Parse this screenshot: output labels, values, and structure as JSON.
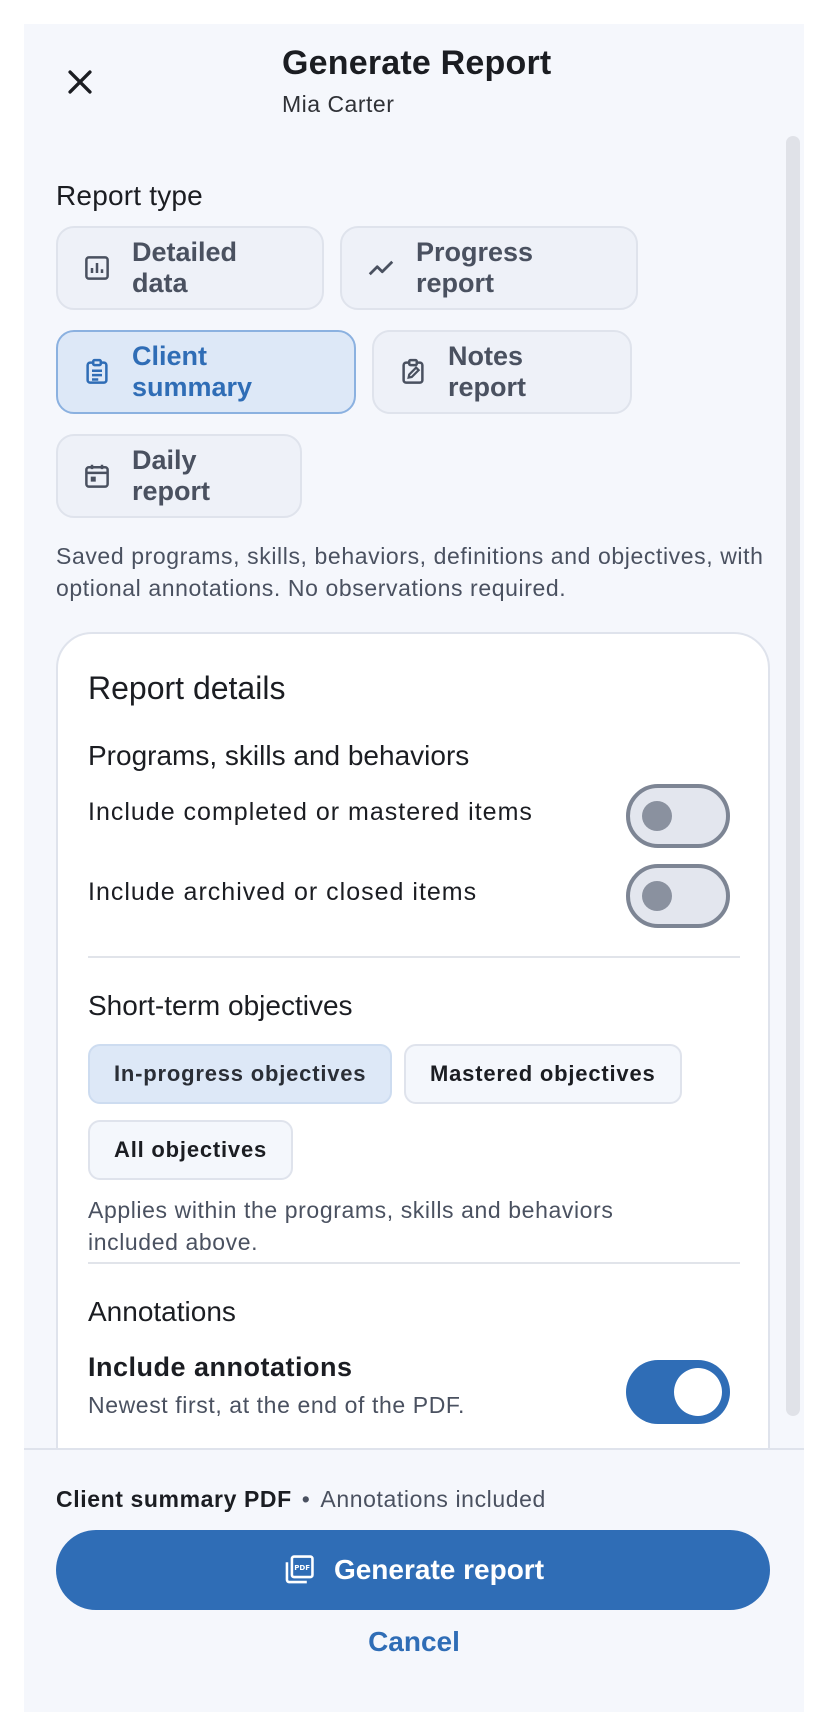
{
  "header": {
    "title": "Generate Report",
    "subtitle": "Mia Carter",
    "close_icon": "close-icon"
  },
  "report_type": {
    "label": "Report type",
    "chips": [
      {
        "label": "Detailed data",
        "icon": "bar-chart-icon",
        "selected": false
      },
      {
        "label": "Progress report",
        "icon": "trending-up-icon",
        "selected": false
      },
      {
        "label": "Client summary",
        "icon": "clipboard-icon",
        "selected": true
      },
      {
        "label": "Notes report",
        "icon": "edit-note-icon",
        "selected": false
      },
      {
        "label": "Daily report",
        "icon": "calendar-icon",
        "selected": false
      }
    ],
    "description": "Saved programs, skills, behaviors, definitions and objectives, with optional annotations. No observations required."
  },
  "details": {
    "title": "Report details",
    "programs": {
      "title": "Programs, skills and behaviors",
      "rows": [
        {
          "label": "Include completed or mastered items",
          "on": false
        },
        {
          "label": "Include archived or closed items",
          "on": false
        }
      ]
    },
    "objectives": {
      "title": "Short-term objectives",
      "options": [
        {
          "label": "In-progress objectives",
          "selected": true
        },
        {
          "label": "Mastered objectives",
          "selected": false
        },
        {
          "label": "All objectives",
          "selected": false
        }
      ],
      "note": "Applies within the programs, skills and behaviors included above."
    },
    "annotations": {
      "title": "Annotations",
      "toggle_label": "Include annotations",
      "toggle_sub": "Newest first, at the end of the PDF.",
      "on": true
    }
  },
  "footer": {
    "summary_bold": "Client summary PDF",
    "summary_sep": "•",
    "summary_rest": "Annotations included",
    "generate_label": "Generate report",
    "generate_icon": "pdf-icon",
    "cancel_label": "Cancel"
  },
  "colors": {
    "accent": "#2f6db6",
    "selected_bg": "#dde8f7",
    "surface": "#f5f7fc"
  }
}
